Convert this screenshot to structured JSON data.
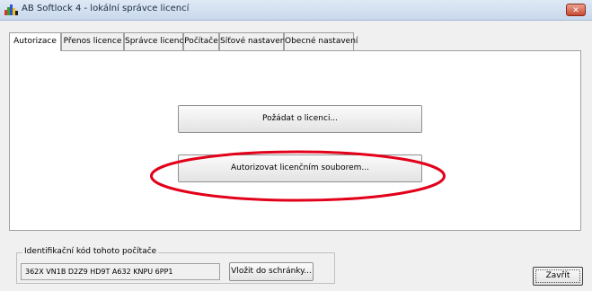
{
  "window": {
    "title": "AB Softlock 4  -  lokální správce licencí",
    "close_symbol": "✕"
  },
  "tabs": [
    {
      "label": "Autorizace",
      "active": true
    },
    {
      "label": "Přenos licence",
      "active": false
    },
    {
      "label": "Správce licencí",
      "active": false
    },
    {
      "label": "Počítače",
      "active": false
    },
    {
      "label": "Síťové nastavení",
      "active": false
    },
    {
      "label": "Obecné nastavení",
      "active": false
    }
  ],
  "authorization": {
    "request_license_button": "Požádat o licenci...",
    "authorize_by_file_button": "Autorizovat licenčním souborem..."
  },
  "computer_id": {
    "group_label": "Identifikační kód tohoto počítače",
    "value": "362X VN1B D2Z9 HD9T A632 KNPU 6PP1",
    "copy_button": "Vložit do schránky..."
  },
  "footer": {
    "close_button": "Zavřít"
  },
  "colors": {
    "annotation": "#e2001a",
    "titlebar": "#c9d8ec"
  },
  "icons": {
    "app": "app-logo-icon",
    "close": "close-icon"
  }
}
